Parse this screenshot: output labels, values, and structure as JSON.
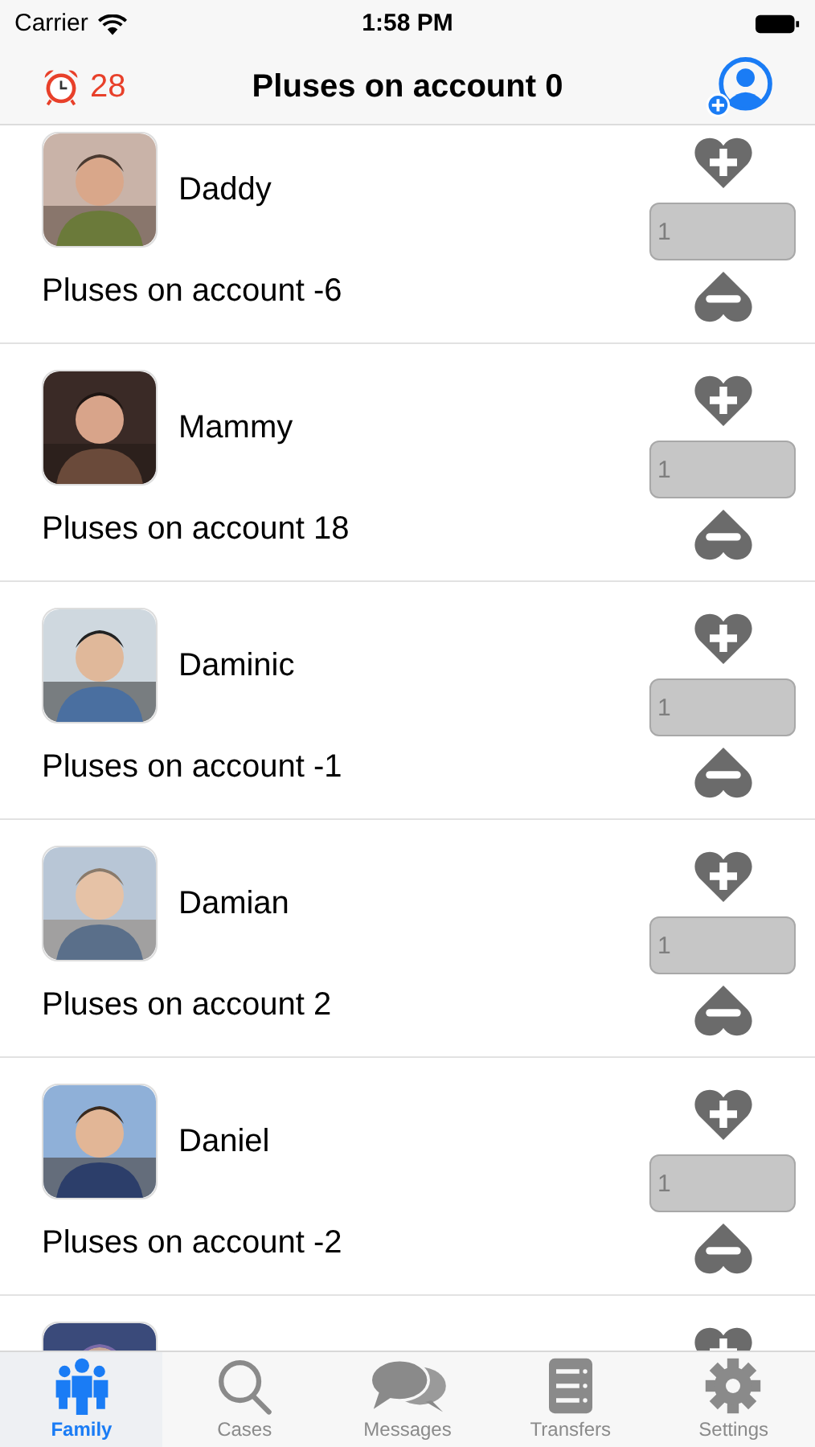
{
  "status_bar": {
    "carrier": "Carrier",
    "time": "1:58 PM"
  },
  "nav_bar": {
    "timer_count": "28",
    "title": "Pluses on account 0"
  },
  "members": [
    {
      "kind": "member",
      "name": "Daddy",
      "account": "Pluses on account -6",
      "amount_placeholder": "1"
    },
    {
      "kind": "member",
      "name": "Mammy",
      "account": "Pluses on account 18",
      "amount_placeholder": "1"
    },
    {
      "kind": "member",
      "name": "Daminic",
      "account": "Pluses on account -1",
      "amount_placeholder": "1"
    },
    {
      "kind": "member",
      "name": "Damian",
      "account": "Pluses on account 2",
      "amount_placeholder": "1"
    },
    {
      "kind": "member",
      "name": "Daniel",
      "account": "Pluses on account -2",
      "amount_placeholder": "1"
    },
    {
      "kind": "partial"
    }
  ],
  "tab_bar": [
    {
      "kind": "family",
      "label": "Family",
      "selected": true
    },
    {
      "kind": "cases",
      "label": "Cases",
      "selected": false
    },
    {
      "kind": "messages",
      "label": "Messages",
      "selected": false
    },
    {
      "kind": "transfers",
      "label": "Transfers",
      "selected": false
    },
    {
      "kind": "settings",
      "label": "Settings",
      "selected": false
    }
  ]
}
